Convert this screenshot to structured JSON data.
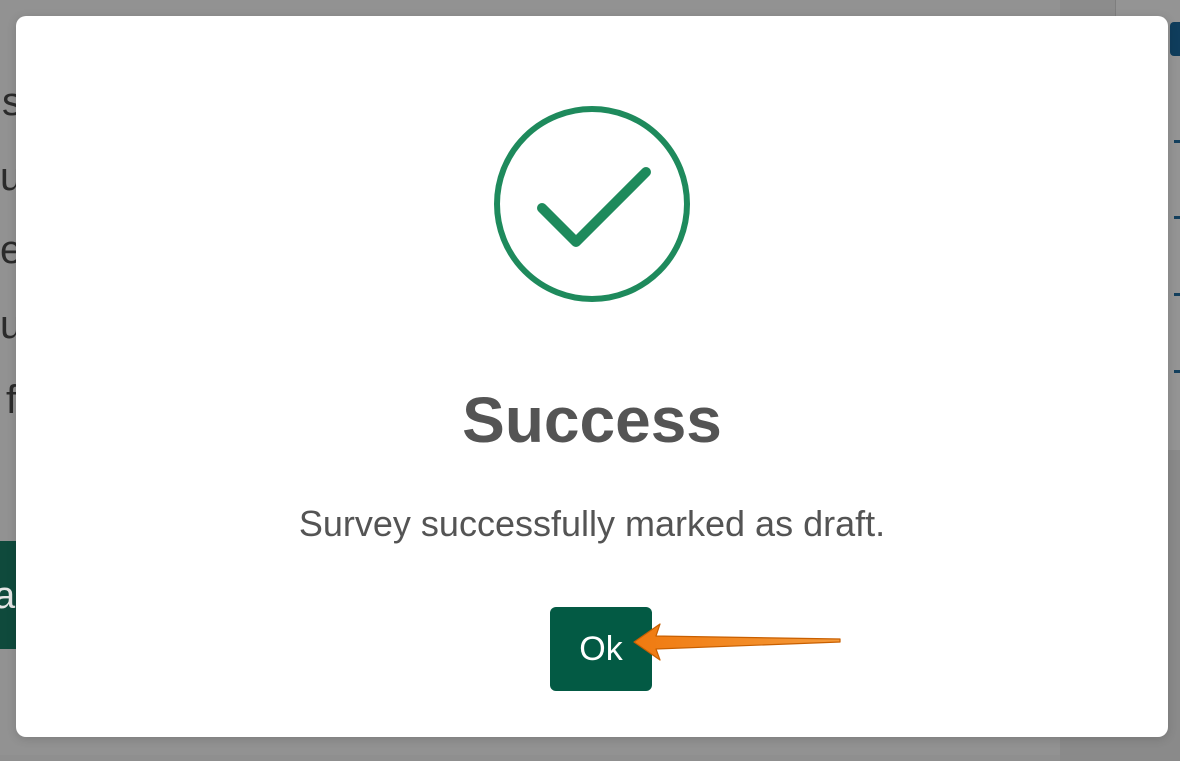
{
  "background": {
    "fragments": [
      "s",
      "u",
      "e",
      "u",
      "f"
    ],
    "side_button_letter": "a"
  },
  "modal": {
    "icon": "success-check-icon",
    "title": "Success",
    "message": "Survey successfully marked as draft.",
    "ok_label": "Ok"
  },
  "annotation": {
    "icon": "orange-arrow-pointer-icon",
    "color": "#f07a10"
  },
  "colors": {
    "success_green": "#1e8a5c",
    "button_green": "#035a44",
    "text_gray": "#545454",
    "overlay": "#8f8f8f"
  }
}
